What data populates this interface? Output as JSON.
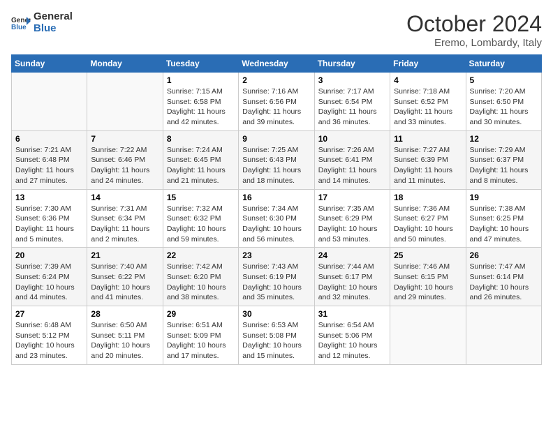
{
  "header": {
    "logo_general": "General",
    "logo_blue": "Blue",
    "month": "October 2024",
    "location": "Eremo, Lombardy, Italy"
  },
  "weekdays": [
    "Sunday",
    "Monday",
    "Tuesday",
    "Wednesday",
    "Thursday",
    "Friday",
    "Saturday"
  ],
  "weeks": [
    [
      {
        "day": "",
        "info": ""
      },
      {
        "day": "",
        "info": ""
      },
      {
        "day": "1",
        "info": "Sunrise: 7:15 AM\nSunset: 6:58 PM\nDaylight: 11 hours and 42 minutes."
      },
      {
        "day": "2",
        "info": "Sunrise: 7:16 AM\nSunset: 6:56 PM\nDaylight: 11 hours and 39 minutes."
      },
      {
        "day": "3",
        "info": "Sunrise: 7:17 AM\nSunset: 6:54 PM\nDaylight: 11 hours and 36 minutes."
      },
      {
        "day": "4",
        "info": "Sunrise: 7:18 AM\nSunset: 6:52 PM\nDaylight: 11 hours and 33 minutes."
      },
      {
        "day": "5",
        "info": "Sunrise: 7:20 AM\nSunset: 6:50 PM\nDaylight: 11 hours and 30 minutes."
      }
    ],
    [
      {
        "day": "6",
        "info": "Sunrise: 7:21 AM\nSunset: 6:48 PM\nDaylight: 11 hours and 27 minutes."
      },
      {
        "day": "7",
        "info": "Sunrise: 7:22 AM\nSunset: 6:46 PM\nDaylight: 11 hours and 24 minutes."
      },
      {
        "day": "8",
        "info": "Sunrise: 7:24 AM\nSunset: 6:45 PM\nDaylight: 11 hours and 21 minutes."
      },
      {
        "day": "9",
        "info": "Sunrise: 7:25 AM\nSunset: 6:43 PM\nDaylight: 11 hours and 18 minutes."
      },
      {
        "day": "10",
        "info": "Sunrise: 7:26 AM\nSunset: 6:41 PM\nDaylight: 11 hours and 14 minutes."
      },
      {
        "day": "11",
        "info": "Sunrise: 7:27 AM\nSunset: 6:39 PM\nDaylight: 11 hours and 11 minutes."
      },
      {
        "day": "12",
        "info": "Sunrise: 7:29 AM\nSunset: 6:37 PM\nDaylight: 11 hours and 8 minutes."
      }
    ],
    [
      {
        "day": "13",
        "info": "Sunrise: 7:30 AM\nSunset: 6:36 PM\nDaylight: 11 hours and 5 minutes."
      },
      {
        "day": "14",
        "info": "Sunrise: 7:31 AM\nSunset: 6:34 PM\nDaylight: 11 hours and 2 minutes."
      },
      {
        "day": "15",
        "info": "Sunrise: 7:32 AM\nSunset: 6:32 PM\nDaylight: 10 hours and 59 minutes."
      },
      {
        "day": "16",
        "info": "Sunrise: 7:34 AM\nSunset: 6:30 PM\nDaylight: 10 hours and 56 minutes."
      },
      {
        "day": "17",
        "info": "Sunrise: 7:35 AM\nSunset: 6:29 PM\nDaylight: 10 hours and 53 minutes."
      },
      {
        "day": "18",
        "info": "Sunrise: 7:36 AM\nSunset: 6:27 PM\nDaylight: 10 hours and 50 minutes."
      },
      {
        "day": "19",
        "info": "Sunrise: 7:38 AM\nSunset: 6:25 PM\nDaylight: 10 hours and 47 minutes."
      }
    ],
    [
      {
        "day": "20",
        "info": "Sunrise: 7:39 AM\nSunset: 6:24 PM\nDaylight: 10 hours and 44 minutes."
      },
      {
        "day": "21",
        "info": "Sunrise: 7:40 AM\nSunset: 6:22 PM\nDaylight: 10 hours and 41 minutes."
      },
      {
        "day": "22",
        "info": "Sunrise: 7:42 AM\nSunset: 6:20 PM\nDaylight: 10 hours and 38 minutes."
      },
      {
        "day": "23",
        "info": "Sunrise: 7:43 AM\nSunset: 6:19 PM\nDaylight: 10 hours and 35 minutes."
      },
      {
        "day": "24",
        "info": "Sunrise: 7:44 AM\nSunset: 6:17 PM\nDaylight: 10 hours and 32 minutes."
      },
      {
        "day": "25",
        "info": "Sunrise: 7:46 AM\nSunset: 6:15 PM\nDaylight: 10 hours and 29 minutes."
      },
      {
        "day": "26",
        "info": "Sunrise: 7:47 AM\nSunset: 6:14 PM\nDaylight: 10 hours and 26 minutes."
      }
    ],
    [
      {
        "day": "27",
        "info": "Sunrise: 6:48 AM\nSunset: 5:12 PM\nDaylight: 10 hours and 23 minutes."
      },
      {
        "day": "28",
        "info": "Sunrise: 6:50 AM\nSunset: 5:11 PM\nDaylight: 10 hours and 20 minutes."
      },
      {
        "day": "29",
        "info": "Sunrise: 6:51 AM\nSunset: 5:09 PM\nDaylight: 10 hours and 17 minutes."
      },
      {
        "day": "30",
        "info": "Sunrise: 6:53 AM\nSunset: 5:08 PM\nDaylight: 10 hours and 15 minutes."
      },
      {
        "day": "31",
        "info": "Sunrise: 6:54 AM\nSunset: 5:06 PM\nDaylight: 10 hours and 12 minutes."
      },
      {
        "day": "",
        "info": ""
      },
      {
        "day": "",
        "info": ""
      }
    ]
  ]
}
